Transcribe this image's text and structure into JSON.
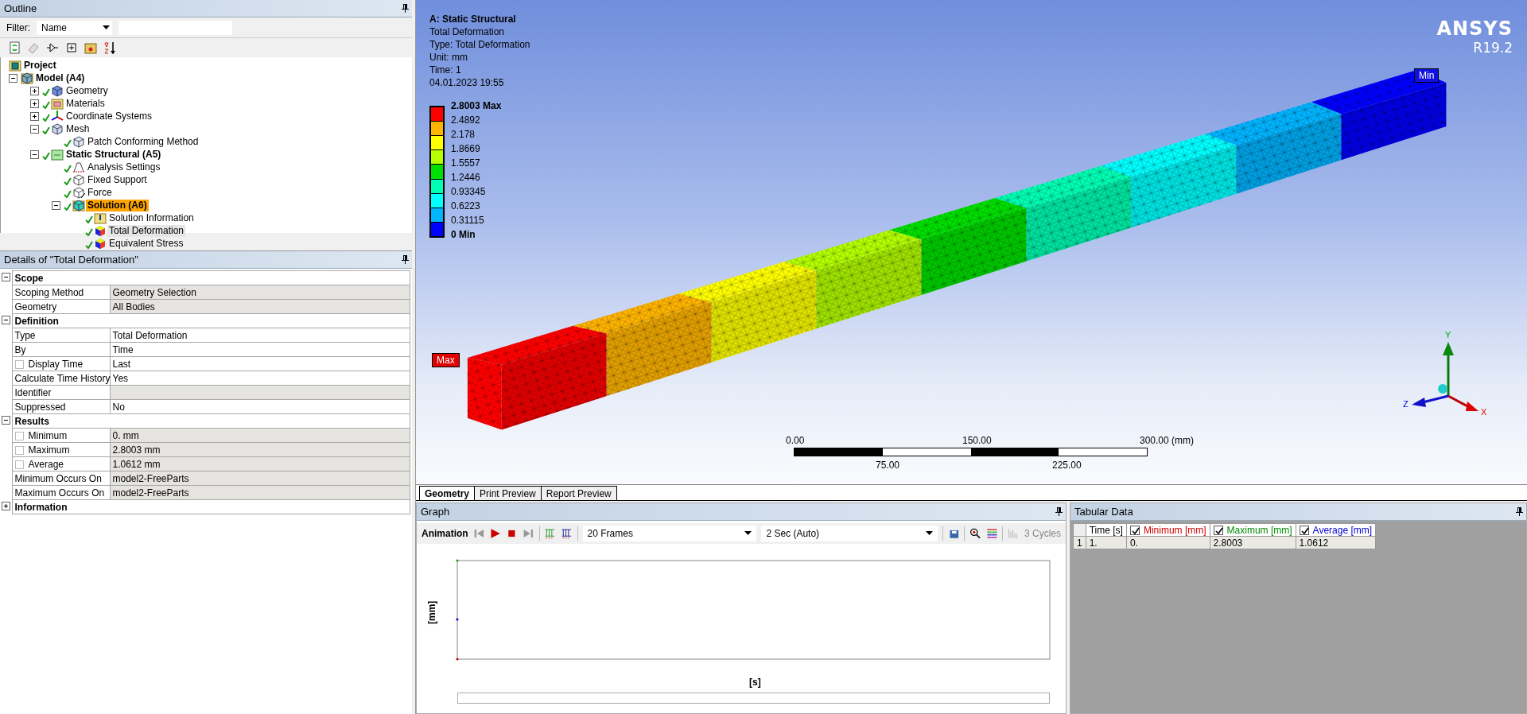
{
  "outline": {
    "title": "Outline",
    "filter": {
      "label": "Filter:",
      "value": "Name"
    },
    "tree": [
      {
        "label": "Project",
        "kind": "project",
        "solved": false,
        "selected": false,
        "highlighted": false,
        "children": [
          {
            "label": "Model (A4)",
            "kind": "model",
            "solved": false,
            "selected": false,
            "highlighted": false,
            "expanded": true,
            "children": [
              {
                "label": "Geometry",
                "kind": "geometry",
                "solved": true,
                "selected": false,
                "highlighted": false,
                "expanded": false
              },
              {
                "label": "Materials",
                "kind": "materials",
                "solved": true,
                "selected": false,
                "highlighted": false,
                "expanded": false
              },
              {
                "label": "Coordinate Systems",
                "kind": "coordinates",
                "solved": true,
                "selected": false,
                "highlighted": false,
                "expanded": false
              },
              {
                "label": "Mesh",
                "kind": "mesh",
                "solved": true,
                "selected": false,
                "highlighted": false,
                "expanded": true,
                "children": [
                  {
                    "label": "Patch Conforming Method",
                    "kind": "method",
                    "solved": true,
                    "selected": false,
                    "highlighted": false
                  }
                ]
              },
              {
                "label": "Static Structural (A5)",
                "kind": "analysis",
                "solved": true,
                "selected": false,
                "highlighted": false,
                "expanded": true,
                "children": [
                  {
                    "label": "Analysis Settings",
                    "kind": "settings",
                    "solved": true,
                    "selected": false,
                    "highlighted": false
                  },
                  {
                    "label": "Fixed Support",
                    "kind": "support",
                    "solved": true,
                    "selected": false,
                    "highlighted": false
                  },
                  {
                    "label": "Force",
                    "kind": "force",
                    "solved": true,
                    "selected": false,
                    "highlighted": false
                  },
                  {
                    "label": "Solution (A6)",
                    "kind": "solution",
                    "solved": true,
                    "selected": true,
                    "highlighted": false,
                    "expanded": true,
                    "children": [
                      {
                        "label": "Solution Information",
                        "kind": "information",
                        "solved": true,
                        "selected": false,
                        "highlighted": false
                      },
                      {
                        "label": "Total Deformation",
                        "kind": "result",
                        "solved": true,
                        "selected": false,
                        "highlighted": true
                      },
                      {
                        "label": "Equivalent Stress",
                        "kind": "result",
                        "solved": true,
                        "selected": false,
                        "highlighted": false
                      }
                    ]
                  }
                ]
              }
            ]
          }
        ]
      }
    ]
  },
  "details": {
    "title": "Details of \"Total Deformation\"",
    "groups": [
      {
        "label": "Scope",
        "expanded": true,
        "rows": [
          {
            "name": "Scoping Method",
            "value": "Geometry Selection",
            "editable": false
          },
          {
            "name": "Geometry",
            "value": "All Bodies",
            "editable": false
          }
        ]
      },
      {
        "label": "Definition",
        "expanded": true,
        "rows": [
          {
            "name": "Type",
            "value": "Total Deformation",
            "editable": true
          },
          {
            "name": "By",
            "value": "Time",
            "editable": true
          },
          {
            "name": "Display Time",
            "value": "Last",
            "editable": true,
            "checked": false
          },
          {
            "name": "Calculate Time History",
            "value": "Yes",
            "editable": true
          },
          {
            "name": "Identifier",
            "editable": false
          },
          {
            "name": "Suppressed",
            "value": "No",
            "editable": true
          }
        ]
      },
      {
        "label": "Results",
        "expanded": true,
        "rows": [
          {
            "name": "Minimum",
            "value": "0. mm",
            "editable": false,
            "checked": false
          },
          {
            "name": "Maximum",
            "value": "2.8003 mm",
            "editable": false,
            "checked": false
          },
          {
            "name": "Average",
            "value": "1.0612 mm",
            "editable": false,
            "checked": false
          },
          {
            "name": "Minimum Occurs On",
            "value": "model2-FreeParts",
            "editable": false
          },
          {
            "name": "Maximum Occurs On",
            "value": "model2-FreeParts",
            "editable": false
          }
        ]
      },
      {
        "label": "Information",
        "expanded": false
      }
    ]
  },
  "viewport": {
    "header": [
      "A: Static Structural",
      "Total Deformation",
      "Type: Total Deformation",
      "Unit: mm",
      "Time: 1",
      "04.01.2023 19:55"
    ],
    "legend": {
      "labels": [
        "2.8003 Max",
        "2.4892",
        "2.178",
        "1.8669",
        "1.5557",
        "1.2446",
        "0.93345",
        "0.6223",
        "0.31115",
        "0 Min"
      ],
      "bands": [
        {
          "color": "#ff0000"
        },
        {
          "color": "#ffb400"
        },
        {
          "color": "#ffff00"
        },
        {
          "color": "#b4ff00"
        },
        {
          "color": "#00e000"
        },
        {
          "color": "#00ffb4"
        },
        {
          "color": "#00ffff"
        },
        {
          "color": "#00b4ff"
        },
        {
          "color": "#0000ff"
        }
      ]
    },
    "brand": {
      "name": "ANSYS",
      "version": "R19.2"
    },
    "probes": [
      {
        "label": "Max",
        "kind": "max"
      },
      {
        "label": "Min",
        "kind": "min"
      }
    ],
    "scale_bar": {
      "top_labels": [
        "0.00",
        "150.00",
        "300.00 (mm)"
      ],
      "bottom_labels": [
        "75.00",
        "225.00"
      ]
    },
    "triad": {
      "x": "X",
      "y": "Y",
      "z": "Z"
    }
  },
  "view_tabs": [
    {
      "label": "Geometry",
      "selected": true
    },
    {
      "label": "Print Preview",
      "selected": false
    },
    {
      "label": "Report Preview",
      "selected": false
    }
  ],
  "graph": {
    "title": "Graph",
    "toolbar": {
      "label": "Animation",
      "frames": "20 Frames",
      "duration": "2 Sec (Auto)",
      "cycles": {
        "label": "3 Cycles",
        "disabled": true
      }
    },
    "y_label": "[mm]",
    "x_label": "[s]"
  },
  "tabular": {
    "title": "Tabular Data",
    "columns": [
      {
        "label": "Time [s]"
      },
      {
        "label": "Minimum [mm]",
        "checked": true,
        "color": "#d40000"
      },
      {
        "label": "Maximum [mm]",
        "checked": true,
        "color": "#008a00"
      },
      {
        "label": "Average [mm]",
        "checked": true,
        "color": "#0000d4"
      }
    ],
    "rows": [
      {
        "index": "1",
        "cells": [
          "1.",
          "0.",
          "2.8003",
          "1.0612"
        ]
      }
    ]
  }
}
